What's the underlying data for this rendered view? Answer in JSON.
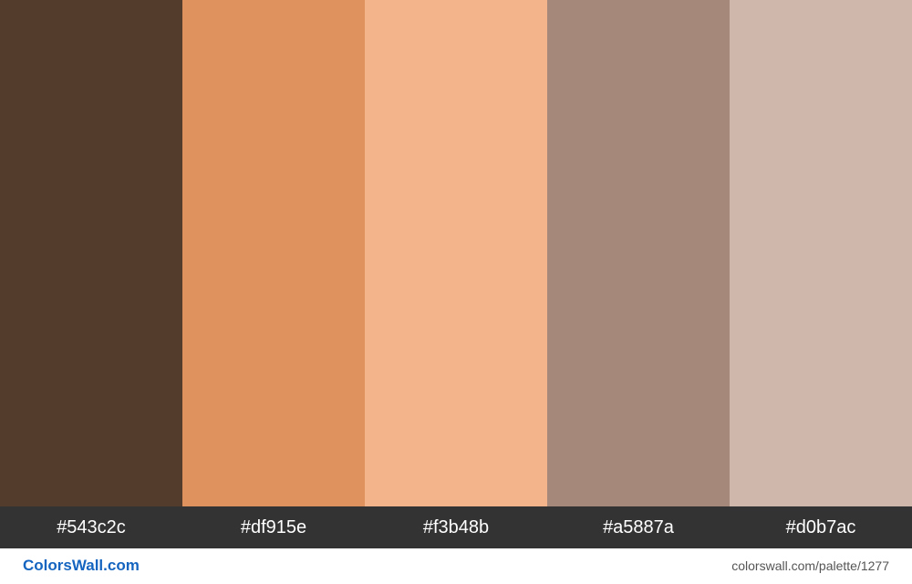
{
  "palette": {
    "colors": [
      {
        "hex": "#543c2c",
        "label": "#543c2c"
      },
      {
        "hex": "#df915e",
        "label": "#df915e"
      },
      {
        "hex": "#f3b48b",
        "label": "#f3b48b"
      },
      {
        "hex": "#a5887a",
        "label": "#a5887a"
      },
      {
        "hex": "#d0b7ac",
        "label": "#d0b7ac"
      }
    ]
  },
  "footer": {
    "brand": "ColorsWall.com",
    "url": "colorswall.com/palette/1277"
  }
}
